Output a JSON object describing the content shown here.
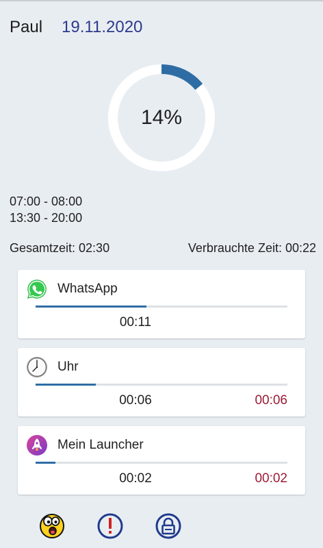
{
  "header": {
    "user": "Paul",
    "date": "19.11.2020"
  },
  "progress": {
    "percent_label": "14%",
    "fraction": 0.14,
    "color": "#2e6da4"
  },
  "schedule": {
    "slots": [
      "07:00 - 08:00",
      "13:30 - 20:00"
    ]
  },
  "totals": {
    "total_label": "Gesamtzeit: 02:30",
    "used_label": "Verbrauchte Zeit: 00:22"
  },
  "apps": [
    {
      "name": "WhatsApp",
      "icon": "whatsapp-icon",
      "used": "00:11",
      "limit": "",
      "usage_fraction": 0.44
    },
    {
      "name": "Uhr",
      "icon": "clock-icon",
      "used": "00:06",
      "limit": "00:06",
      "usage_fraction": 0.24
    },
    {
      "name": "Mein Launcher",
      "icon": "rocket-launcher-icon",
      "used": "00:02",
      "limit": "00:02",
      "usage_fraction": 0.08
    }
  ],
  "bottom_bar": {
    "icons": [
      "surprised-face-icon",
      "alert-icon",
      "lock-icon"
    ],
    "icon_color": "#1f3a8c"
  },
  "colors": {
    "accent": "#2e6da4",
    "date": "#2c3a8c",
    "limit": "#9c1c36",
    "background": "#e8edf2"
  }
}
